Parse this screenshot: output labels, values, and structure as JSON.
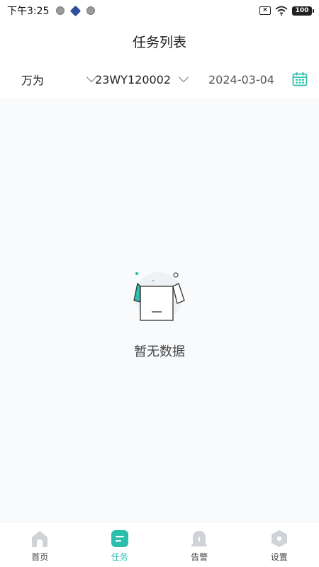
{
  "status_bar": {
    "time": "下午3:25",
    "battery": "100"
  },
  "header": {
    "title": "任务列表"
  },
  "filters": {
    "company": "万为",
    "device": "23WY120002",
    "date": "2024-03-04"
  },
  "empty_state": {
    "text": "暂无数据"
  },
  "bottom_nav": {
    "items": [
      {
        "label": "首页",
        "icon": "home-icon"
      },
      {
        "label": "任务",
        "icon": "task-icon",
        "active": true
      },
      {
        "label": "告警",
        "icon": "bell-icon"
      },
      {
        "label": "设置",
        "icon": "settings-icon"
      }
    ]
  },
  "colors": {
    "accent": "#2bbfae",
    "inactive_icon": "#cfd3d8",
    "content_bg": "#f8fafc"
  }
}
